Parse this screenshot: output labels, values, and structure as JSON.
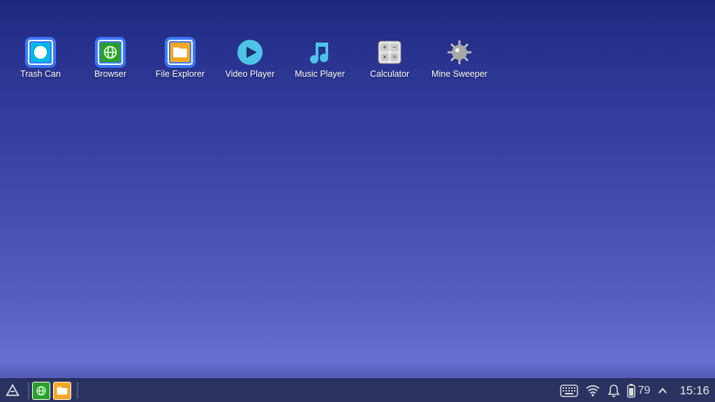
{
  "desktop": {
    "icons": [
      {
        "name": "trash-can",
        "label": "Trash Can"
      },
      {
        "name": "browser",
        "label": "Browser"
      },
      {
        "name": "file-explorer",
        "label": "File Explorer"
      },
      {
        "name": "video-player",
        "label": "Video Player"
      },
      {
        "name": "music-player",
        "label": "Music Player"
      },
      {
        "name": "calculator",
        "label": "Calculator"
      },
      {
        "name": "mine-sweeper",
        "label": "Mine Sweeper"
      }
    ]
  },
  "taskbar": {
    "pinned": [
      {
        "name": "browser"
      },
      {
        "name": "file-explorer"
      }
    ],
    "battery_level": "79",
    "clock": "15:16"
  }
}
